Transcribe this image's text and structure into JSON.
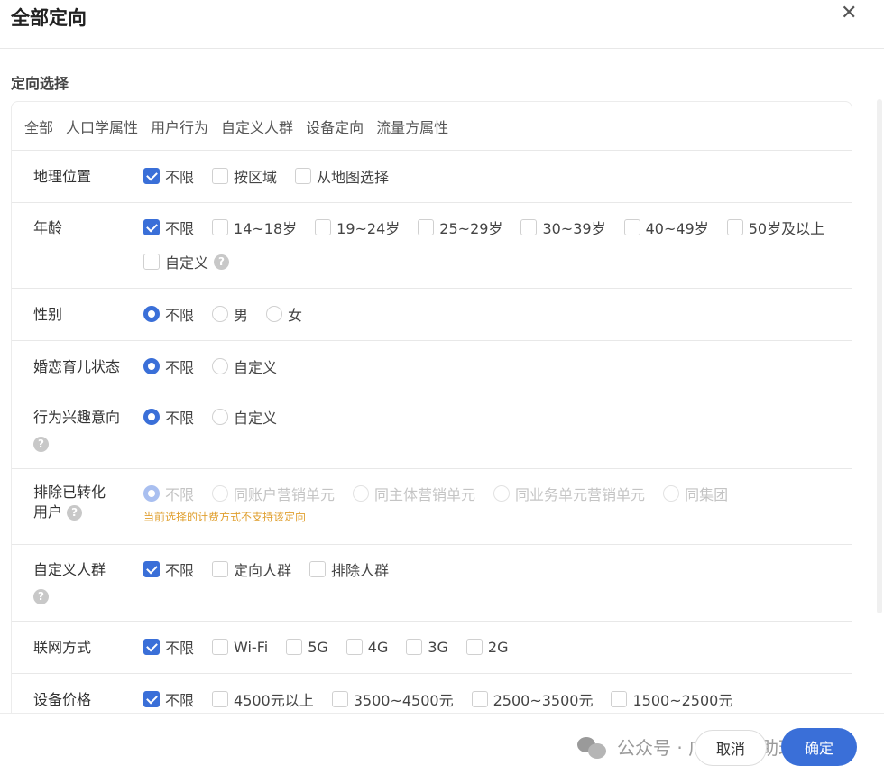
{
  "dialog": {
    "title": "全部定向",
    "section_title": "定向选择",
    "close_icon": "close-icon"
  },
  "tabs": [
    "全部",
    "人口学属性",
    "用户行为",
    "自定义人群",
    "设备定向",
    "流量方属性"
  ],
  "rows": {
    "geo": {
      "label": "地理位置",
      "control": "checkbox",
      "options": [
        {
          "label": "不限",
          "checked": true
        },
        {
          "label": "按区域",
          "checked": false
        },
        {
          "label": "从地图选择",
          "checked": false
        }
      ]
    },
    "age": {
      "label": "年龄",
      "control": "checkbox",
      "options": [
        {
          "label": "不限",
          "checked": true
        },
        {
          "label": "14~18岁",
          "checked": false
        },
        {
          "label": "19~24岁",
          "checked": false
        },
        {
          "label": "25~29岁",
          "checked": false
        },
        {
          "label": "30~39岁",
          "checked": false
        },
        {
          "label": "40~49岁",
          "checked": false
        },
        {
          "label": "50岁及以上",
          "checked": false
        },
        {
          "label": "自定义",
          "checked": false
        }
      ]
    },
    "gender": {
      "label": "性别",
      "control": "radio",
      "options": [
        {
          "label": "不限",
          "checked": true
        },
        {
          "label": "男",
          "checked": false
        },
        {
          "label": "女",
          "checked": false
        }
      ]
    },
    "marital": {
      "label": "婚恋育儿状态",
      "control": "radio",
      "options": [
        {
          "label": "不限",
          "checked": true
        },
        {
          "label": "自定义",
          "checked": false
        }
      ]
    },
    "interest": {
      "label": "行为兴趣意向",
      "control": "radio",
      "options": [
        {
          "label": "不限",
          "checked": true
        },
        {
          "label": "自定义",
          "checked": false
        }
      ]
    },
    "exclude": {
      "label_line1": "排除已转化",
      "label_line2": "用户",
      "control": "radio",
      "disabled": true,
      "options": [
        {
          "label": "不限",
          "checked": true
        },
        {
          "label": "同账户营销单元",
          "checked": false
        },
        {
          "label": "同主体营销单元",
          "checked": false
        },
        {
          "label": "同业务单元营销单元",
          "checked": false
        },
        {
          "label": "同集团",
          "checked": false
        }
      ],
      "warning": "当前选择的计费方式不支持该定向"
    },
    "audience": {
      "label": "自定义人群",
      "control": "checkbox",
      "options": [
        {
          "label": "不限",
          "checked": true
        },
        {
          "label": "定向人群",
          "checked": false
        },
        {
          "label": "排除人群",
          "checked": false
        }
      ]
    },
    "network": {
      "label": "联网方式",
      "control": "checkbox",
      "options": [
        {
          "label": "不限",
          "checked": true
        },
        {
          "label": "Wi-Fi",
          "checked": false
        },
        {
          "label": "5G",
          "checked": false
        },
        {
          "label": "4G",
          "checked": false
        },
        {
          "label": "3G",
          "checked": false
        },
        {
          "label": "2G",
          "checked": false
        }
      ]
    },
    "price": {
      "label": "设备价格",
      "control": "checkbox",
      "options": [
        {
          "label": "不限",
          "checked": true
        },
        {
          "label": "4500元以上",
          "checked": false
        },
        {
          "label": "3500~4500元",
          "checked": false
        },
        {
          "label": "2500~3500元",
          "checked": false
        },
        {
          "label": "1500~2500元",
          "checked": false
        }
      ]
    }
  },
  "help_glyph": "?",
  "footer": {
    "watermark": "公众号 · 广告推广助理",
    "cancel": "取消",
    "confirm": "确定"
  },
  "colors": {
    "primary": "#3a6fd8",
    "warning": "#e0a030",
    "disabled": "#c4c4c4"
  }
}
